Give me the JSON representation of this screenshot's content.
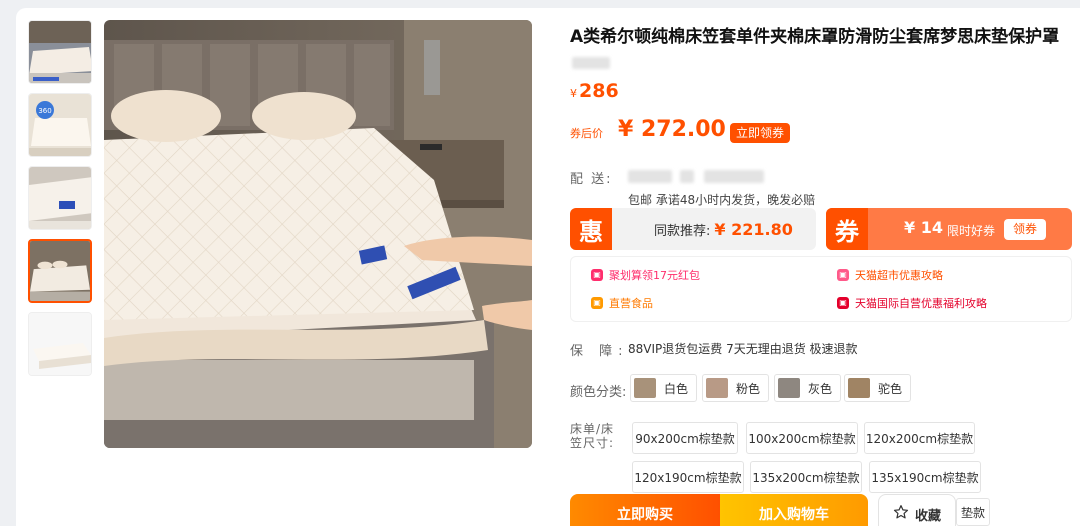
{
  "product": {
    "title": "A类希尔顿纯棉床笠套单件夹棉床罩防滑防尘套席梦思床垫保护罩"
  },
  "price": {
    "currency": "¥",
    "original": "286",
    "coupon_label": "券后价",
    "coupon_price": "¥ 272.00",
    "get_coupon": "立即领券"
  },
  "shipping": {
    "label": "配 送:",
    "detail": "包邮  承诺48小时内发货，晚发必赔"
  },
  "promo": {
    "hui_char": "惠",
    "same_item_label": "同款推荐:",
    "same_item_price": "¥ 221.80",
    "quan_char": "券",
    "coupon_amount": "¥ 14",
    "coupon_limit": "限时好券",
    "coupon_button": "领券"
  },
  "benefits": [
    {
      "text": "聚划算领17元红包",
      "color": "#ff2e6d"
    },
    {
      "text": "天猫超市优惠攻略",
      "color": "#ff5000"
    },
    {
      "text": "直营食品",
      "color": "#ff9a00"
    },
    {
      "text": "天猫国际自营优惠福利攻略",
      "color": "#e4002b"
    }
  ],
  "guarantee": {
    "label": "保 障:",
    "text": "88VIP退货包运费  7天无理由退货  极速退款"
  },
  "color_select": {
    "label": "颜色分类:",
    "options": [
      "白色",
      "粉色",
      "灰色",
      "驼色"
    ]
  },
  "size_select": {
    "label": "床单/床笠尺寸:",
    "options": [
      "90x200cm棕垫款",
      "100x200cm棕垫款",
      "120x200cm棕垫款",
      "120x190cm棕垫款",
      "135x200cm棕垫款",
      "135x190cm棕垫款",
      "垫款"
    ]
  },
  "actions": {
    "buy_now": "立即购买",
    "add_to_cart": "加入购物车",
    "favorite": "收藏"
  },
  "colors": {
    "accent": "#ff5000",
    "accent_light": "#ff7a45",
    "cart_gradient_end": "#ff9a00"
  },
  "icons": {
    "favorite": "star-icon"
  }
}
